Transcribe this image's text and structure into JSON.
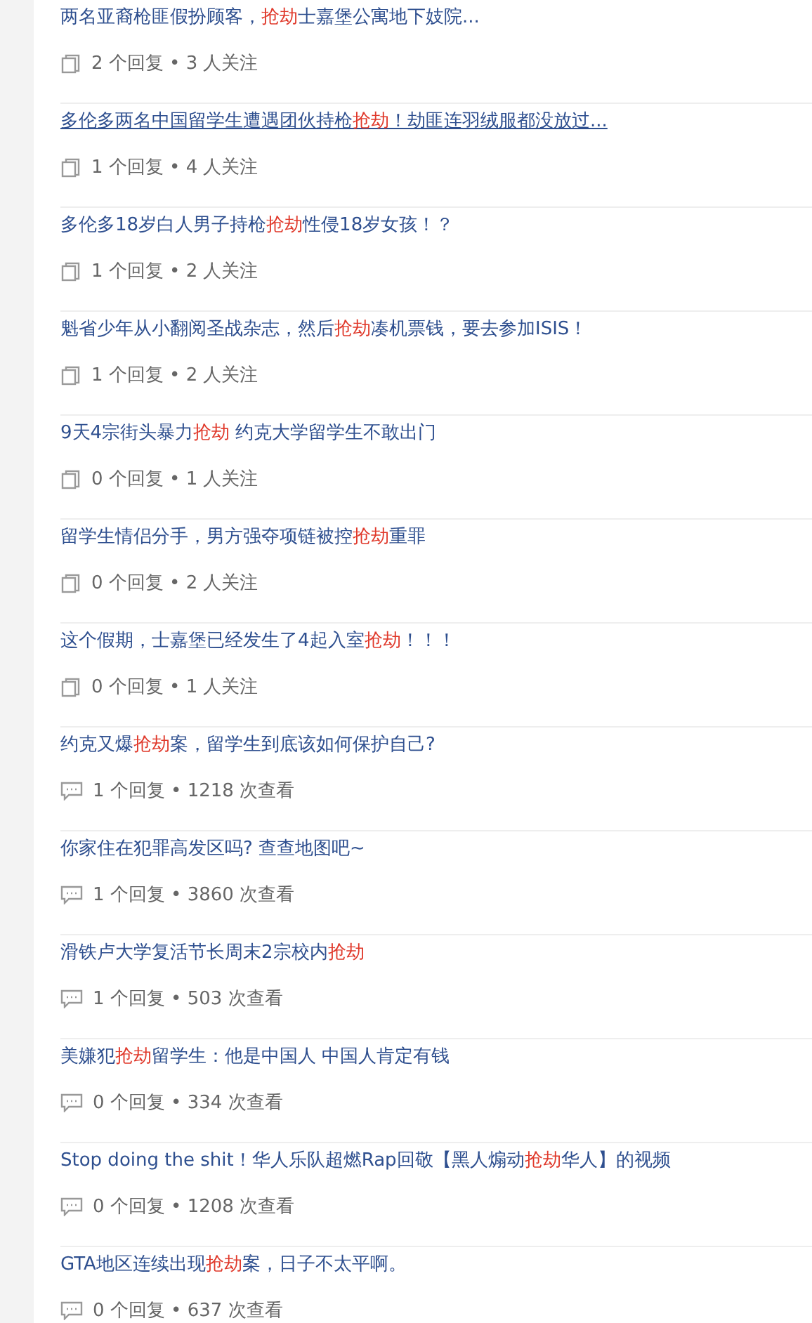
{
  "items": [
    {
      "title": [
        {
          "text": "两名亚裔枪匪假扮顾客，",
          "highlight": false
        },
        {
          "text": "抢劫",
          "highlight": true
        },
        {
          "text": "士嘉堡公寓地下妓院...",
          "highlight": false
        }
      ],
      "hovered": false,
      "kind": "doc",
      "meta": "2 个回复 • 3 人关注"
    },
    {
      "title": [
        {
          "text": "多伦多两名中国留学生遭遇团伙持枪",
          "highlight": false
        },
        {
          "text": "抢劫",
          "highlight": true
        },
        {
          "text": "！劫匪连羽绒服都没放过...",
          "highlight": false
        }
      ],
      "hovered": true,
      "kind": "doc",
      "meta": "1 个回复 • 4 人关注"
    },
    {
      "title": [
        {
          "text": "多伦多18岁白人男子持枪",
          "highlight": false
        },
        {
          "text": "抢劫",
          "highlight": true
        },
        {
          "text": "性侵18岁女孩！？",
          "highlight": false
        }
      ],
      "hovered": false,
      "kind": "doc",
      "meta": "1 个回复 • 2 人关注"
    },
    {
      "title": [
        {
          "text": "魁省少年从小翻阅圣战杂志，然后",
          "highlight": false
        },
        {
          "text": "抢劫",
          "highlight": true
        },
        {
          "text": "凑机票钱，要去参加ISIS！",
          "highlight": false
        }
      ],
      "hovered": false,
      "kind": "doc",
      "meta": "1 个回复 • 2 人关注"
    },
    {
      "title": [
        {
          "text": "9天4宗街头暴力",
          "highlight": false
        },
        {
          "text": "抢劫",
          "highlight": true
        },
        {
          "text": " 约克大学留学生不敢出门",
          "highlight": false
        }
      ],
      "hovered": false,
      "kind": "doc",
      "meta": "0 个回复 • 1 人关注"
    },
    {
      "title": [
        {
          "text": "留学生情侣分手，男方强夺项链被控",
          "highlight": false
        },
        {
          "text": "抢劫",
          "highlight": true
        },
        {
          "text": "重罪",
          "highlight": false
        }
      ],
      "hovered": false,
      "kind": "doc",
      "meta": "0 个回复 • 2 人关注"
    },
    {
      "title": [
        {
          "text": "这个假期，士嘉堡已经发生了4起入室",
          "highlight": false
        },
        {
          "text": "抢劫",
          "highlight": true
        },
        {
          "text": "！！！",
          "highlight": false
        }
      ],
      "hovered": false,
      "kind": "doc",
      "meta": "0 个回复 • 1 人关注"
    },
    {
      "title": [
        {
          "text": "约克又爆",
          "highlight": false
        },
        {
          "text": "抢劫",
          "highlight": true
        },
        {
          "text": "案，留学生到底该如何保护自己?",
          "highlight": false
        }
      ],
      "hovered": false,
      "kind": "comment",
      "meta": "1 个回复 • 1218 次查看"
    },
    {
      "title": [
        {
          "text": "你家住在犯罪高发区吗? 查查地图吧~",
          "highlight": false
        }
      ],
      "hovered": false,
      "kind": "comment",
      "meta": "1 个回复 • 3860 次查看"
    },
    {
      "title": [
        {
          "text": "滑铁卢大学复活节长周末2宗校内",
          "highlight": false
        },
        {
          "text": "抢劫",
          "highlight": true
        }
      ],
      "hovered": false,
      "kind": "comment",
      "meta": "1 个回复 • 503 次查看"
    },
    {
      "title": [
        {
          "text": "美嫌犯",
          "highlight": false
        },
        {
          "text": "抢劫",
          "highlight": true
        },
        {
          "text": "留学生：他是中国人 中国人肯定有钱",
          "highlight": false
        }
      ],
      "hovered": false,
      "kind": "comment",
      "meta": "0 个回复 • 334 次查看"
    },
    {
      "title": [
        {
          "text": "Stop doing the shit！华人乐队超燃Rap回敬【黑人煽动",
          "highlight": false
        },
        {
          "text": "抢劫",
          "highlight": true
        },
        {
          "text": "华人】的视频",
          "highlight": false
        }
      ],
      "hovered": false,
      "kind": "comment",
      "meta": "0 个回复 • 1208 次查看"
    },
    {
      "title": [
        {
          "text": "GTA地区连续出现",
          "highlight": false
        },
        {
          "text": "抢劫",
          "highlight": true
        },
        {
          "text": "案，日子不太平啊。",
          "highlight": false
        }
      ],
      "hovered": false,
      "kind": "comment",
      "meta": "0 个回复 • 637 次查看"
    }
  ]
}
